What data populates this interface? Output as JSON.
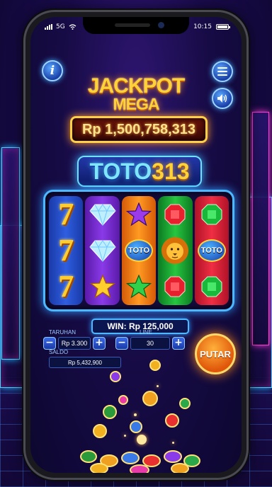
{
  "status_bar": {
    "network": "5G",
    "time": "10:15"
  },
  "top_buttons": {
    "info_label": "i"
  },
  "jackpot": {
    "title_line1": "JACKPOT",
    "title_line2": "MEGA",
    "amount": "Rp 1,500,758,313"
  },
  "brand": {
    "name_part1": "TOTO",
    "name_part2": "313"
  },
  "reels": [
    [
      "seven",
      "seven",
      "seven"
    ],
    [
      "diamond",
      "diamond",
      "star"
    ],
    [
      "star",
      "toto-coin",
      "star"
    ],
    [
      "ruby",
      "lion",
      "ruby"
    ],
    [
      "emerald",
      "toto-coin",
      "emerald"
    ]
  ],
  "symbol_labels": {
    "seven": "7",
    "toto_coin": "TOTO"
  },
  "win": {
    "text": "WIN: Rp 125,000"
  },
  "controls": {
    "bet_label": "TARUHAN",
    "bet_value": "Rp 3.300",
    "line_label": "LINE",
    "line_value": "30",
    "saldo_label": "SALDO",
    "saldo_value": "Rp 5,432,900",
    "minus": "−",
    "plus": "+",
    "spin_label": "PUTAR"
  },
  "colors": {
    "accent_gold": "#ffd23a",
    "neon_blue": "#4db8ff",
    "spin_orange": "#ff8a1a"
  }
}
